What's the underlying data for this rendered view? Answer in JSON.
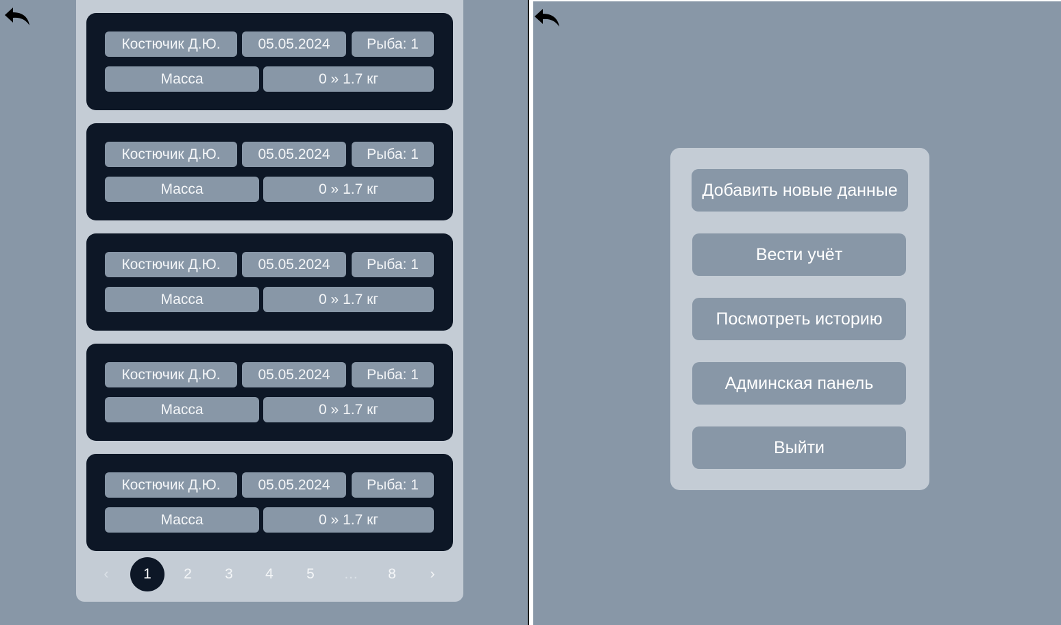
{
  "records": [
    {
      "name": "Костючик Д.Ю.",
      "date": "05.05.2024",
      "fish": "Рыба: 1",
      "metric": "Масса",
      "value": "0 » 1.7 кг"
    },
    {
      "name": "Костючик Д.Ю.",
      "date": "05.05.2024",
      "fish": "Рыба: 1",
      "metric": "Масса",
      "value": "0 » 1.7 кг"
    },
    {
      "name": "Костючик Д.Ю.",
      "date": "05.05.2024",
      "fish": "Рыба: 1",
      "metric": "Масса",
      "value": "0 » 1.7 кг"
    },
    {
      "name": "Костючик Д.Ю.",
      "date": "05.05.2024",
      "fish": "Рыба: 1",
      "metric": "Масса",
      "value": "0 » 1.7 кг"
    },
    {
      "name": "Костючик Д.Ю.",
      "date": "05.05.2024",
      "fish": "Рыба: 1",
      "metric": "Масса",
      "value": "0 » 1.7 кг"
    }
  ],
  "pagination": {
    "prev": "‹",
    "pages": [
      "1",
      "2",
      "3",
      "4",
      "5",
      "…",
      "8"
    ],
    "current": "1",
    "next": "›"
  },
  "menu": {
    "add_new": "Добавить новые данные",
    "keep_record": "Вести учёт",
    "view_history": "Посмотреть историю",
    "admin_panel": "Админская панель",
    "logout": "Выйти"
  },
  "icons": {
    "back": "back-arrow-icon"
  },
  "colors": {
    "background": "#8897a7",
    "container": "#c4ccd5",
    "card": "#0d1726",
    "pill": "#8897a7",
    "text_light": "#f4f6f8"
  }
}
